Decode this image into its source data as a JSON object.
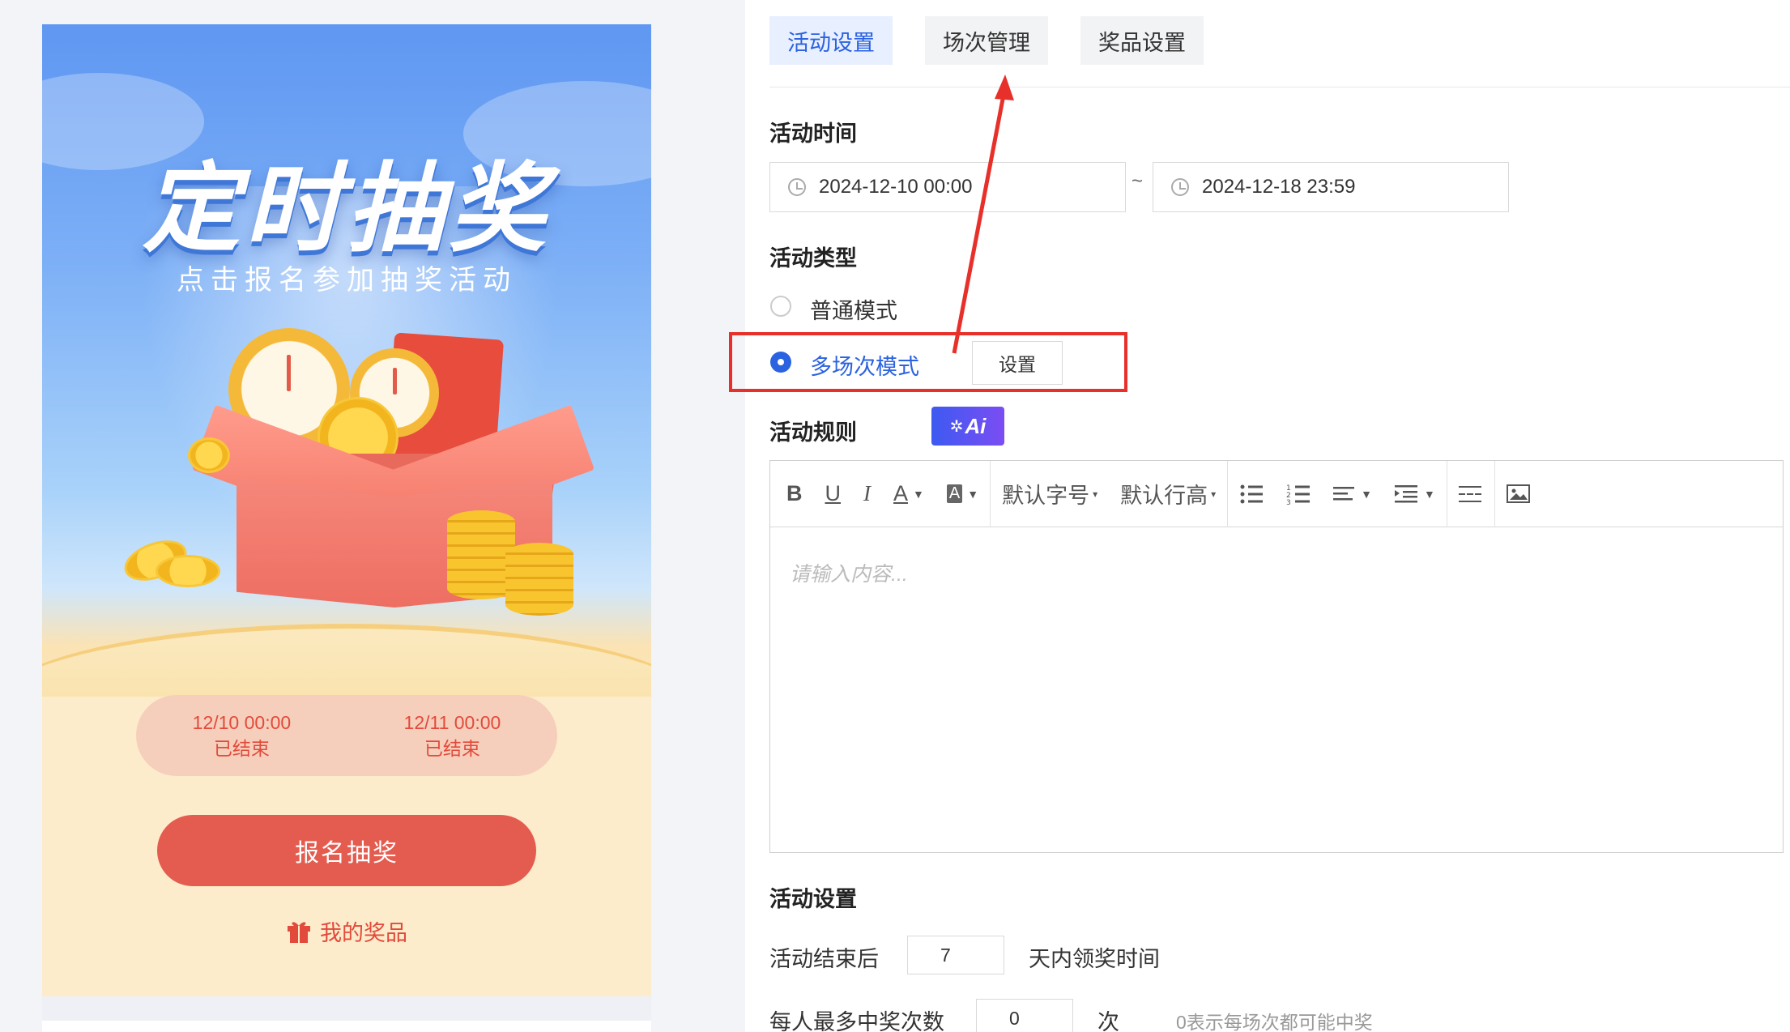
{
  "preview": {
    "title": "定时抽奖",
    "subtitle": "点击报名参加抽奖活动",
    "sessions": [
      {
        "time": "12/10 00:00",
        "status": "已结束"
      },
      {
        "time": "12/11 00:00",
        "status": "已结束"
      }
    ],
    "signup_label": "报名抽奖",
    "my_prize_label": "我的奖品"
  },
  "tabs": [
    {
      "label": "活动设置",
      "active": true
    },
    {
      "label": "场次管理",
      "active": false
    },
    {
      "label": "奖品设置",
      "active": false
    }
  ],
  "activity_time": {
    "label": "活动时间",
    "start": "2024-12-10 00:00",
    "separator": "~",
    "end": "2024-12-18 23:59"
  },
  "activity_type": {
    "label": "活动类型",
    "options": [
      {
        "label": "普通模式",
        "selected": false
      },
      {
        "label": "多场次模式",
        "selected": true
      }
    ],
    "settings_button": "设置"
  },
  "rules": {
    "label": "活动规则",
    "ai_label": "Ai",
    "toolbar": {
      "font_size": "默认字号",
      "line_height": "默认行高"
    },
    "placeholder": "请输入内容..."
  },
  "settings": {
    "label": "活动设置",
    "claim_prefix": "活动结束后",
    "claim_days": "7",
    "claim_suffix": "天内领奖时间",
    "max_win_label": "每人最多中奖次数",
    "max_win_value": "0",
    "max_win_unit": "次",
    "max_win_hint": "0表示每场次都可能中奖"
  },
  "colors": {
    "accent": "#2b62e0",
    "highlight_box": "#e8302a",
    "cta": "#e45c4f"
  }
}
